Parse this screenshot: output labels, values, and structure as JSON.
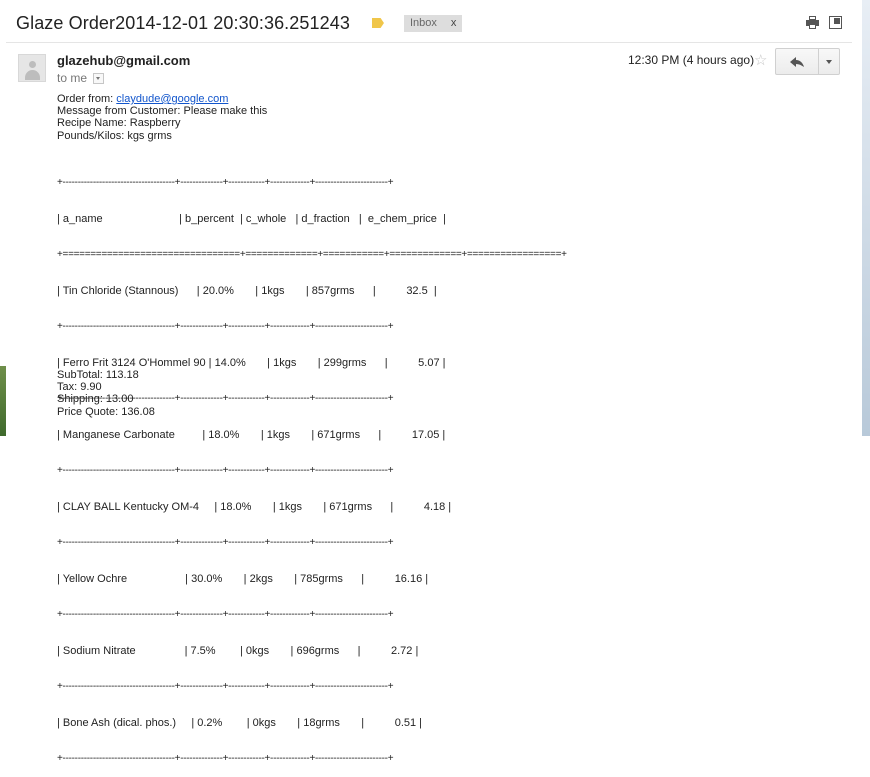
{
  "subject": "Glaze Order2014-12-01 20:30:36.251243",
  "label_chip": {
    "text": "Inbox",
    "remove": "x"
  },
  "colors": {
    "label_tag": "#f0c64a",
    "link": "#1155cc"
  },
  "icons": [
    "label-tag-icon",
    "printer-icon",
    "new-window-icon",
    "star-icon",
    "reply-icon",
    "chevron-down-icon"
  ],
  "sender": "glazehub@gmail.com",
  "to": "to me",
  "time": "12:30 PM (4 hours ago)",
  "star_glyph": "☆",
  "body": {
    "order_from_label": "Order from: ",
    "order_from_email": "claydude@google.com",
    "message": "Message from Customer: Please make this",
    "recipe": "Recipe Name: Raspberry",
    "units": "Pounds/Kilos: kgs grms"
  },
  "table": {
    "top_border": "+-------------------------------------+--------------+------------+-------------+------------------------+",
    "header_line": "| a_name                         | b_percent  | c_whole   | d_fraction   |  e_chem_price  |",
    "header_sep": "+================================+=============+===========+=============+=================+",
    "row_sep": "+-------------------------------------+--------------+------------+-------------+------------------------+",
    "rows": [
      "| Tin Chloride (Stannous)      | 20.0%       | 1kgs       | 857grms      |          32.5  |",
      "| Ferro Frit 3124 O'Hommel 90 | 14.0%       | 1kgs       | 299grms      |          5.07 |",
      "| Manganese Carbonate         | 18.0%       | 1kgs       | 671grms      |          17.05 |",
      "| CLAY BALL Kentucky OM-4     | 18.0%       | 1kgs       | 671grms      |          4.18 |",
      "| Yellow Ochre                   | 30.0%       | 2kgs       | 785grms      |          16.16 |",
      "| Sodium Nitrate                | 7.5%        | 0kgs       | 696grms      |          2.72 |",
      "| Bone Ash (dical. phos.)     | 0.2%        | 0kgs       | 18grms       |          0.51 |"
    ]
  },
  "totals": {
    "subtotal": "SubTotal: 113.18",
    "tax": "Tax: 9.90",
    "shipping": "Shipping: 13.00",
    "quote": "Price Quote: 136.08"
  }
}
